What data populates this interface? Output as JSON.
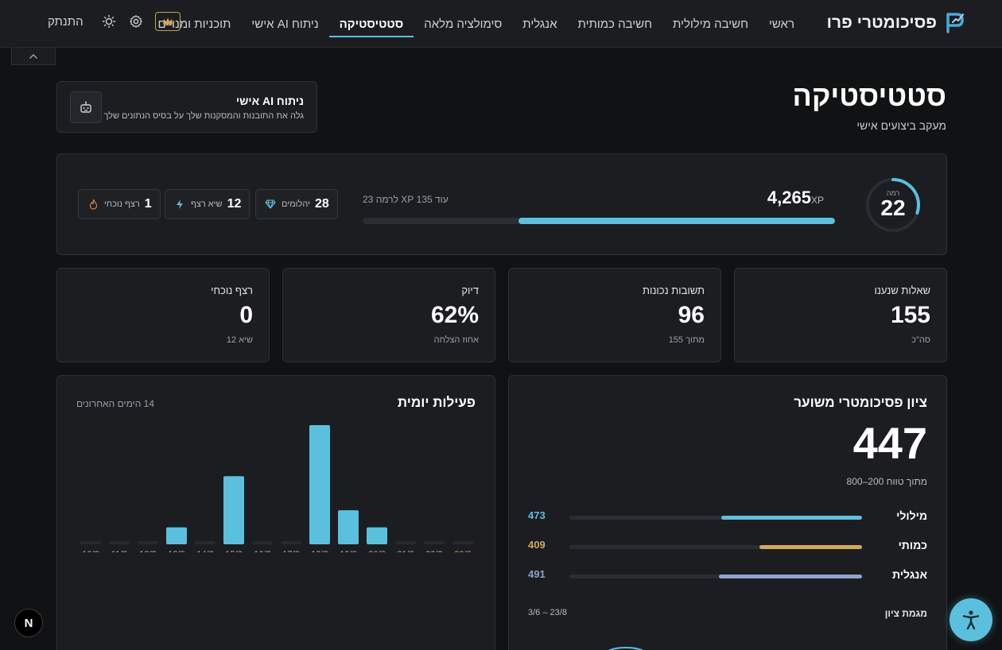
{
  "brand": {
    "name": "פסיכומטרי פרו"
  },
  "nav": {
    "items": [
      {
        "label": "ראשי",
        "active": false
      },
      {
        "label": "חשיבה מילולית",
        "active": false
      },
      {
        "label": "חשיבה כמותית",
        "active": false
      },
      {
        "label": "אנגלית",
        "active": false
      },
      {
        "label": "סימולציה מלאה",
        "active": false
      },
      {
        "label": "סטטיסטיקה",
        "active": true
      },
      {
        "label": "ניתוח AI אישי",
        "active": false
      },
      {
        "label": "תוכניות ומנויים",
        "active": false
      }
    ],
    "logout_label": "התנתק",
    "icons": {
      "premium": "crown-icon",
      "settings": "gear-icon",
      "theme": "sun-icon"
    }
  },
  "header": {
    "title": "סטטיסטיקה",
    "subtitle": "מעקב ביצועים אישי"
  },
  "ai_card": {
    "title": "ניתוח AI אישי",
    "description": "גלה את התובנות והמסקנות שלך על בסיס הנתונים שלך"
  },
  "level": {
    "label": "רמה",
    "value": "22",
    "ring_progress": 0.3,
    "xp": "4,265",
    "xp_unit": "XP",
    "next_text": "עוד 135 XP לרמה 23",
    "progress": 0.67
  },
  "chips": [
    {
      "value": "28",
      "label": "יהלומים",
      "icon": "diamond-icon"
    },
    {
      "value": "12",
      "label": "שיא רצף",
      "icon": "lightning-icon"
    },
    {
      "value": "1",
      "label": "רצף נוכחי",
      "icon": "flame-icon"
    }
  ],
  "summary": [
    {
      "label": "שאלות שנענו",
      "value": "155",
      "sub": "סה\"כ"
    },
    {
      "label": "תשובות נכונות",
      "value": "96",
      "sub": "מתוך 155"
    },
    {
      "label": "דיוק",
      "value": "62%",
      "sub": "אחוז הצלחה"
    },
    {
      "label": "רצף נוכחי",
      "value": "0",
      "sub": "שיא 12"
    }
  ],
  "score": {
    "title": "ציון פסיכומטרי משוער",
    "value": "447",
    "range_text": "מתוך טווח 200–800",
    "subjects": [
      {
        "name": "מילולי",
        "value": "473",
        "color": "#5bc0de",
        "fraction": 0.48
      },
      {
        "name": "כמותי",
        "value": "409",
        "color": "#d4a85a",
        "fraction": 0.35
      },
      {
        "name": "אנגלית",
        "value": "491",
        "color": "#8fa3cc",
        "fraction": 0.49
      }
    ],
    "trend_label": "מגמת ציון",
    "trend_range": "3/6 – 23/8"
  },
  "activity": {
    "title": "פעילות יומית",
    "subtitle": "14 הימים האחרונים"
  },
  "chart_data": {
    "type": "bar",
    "categories": [
      "10/8",
      "11/8",
      "12/8",
      "13/8",
      "14/8",
      "15/8",
      "16/8",
      "17/8",
      "18/8",
      "19/8",
      "20/8",
      "21/8",
      "22/8",
      "23/8"
    ],
    "values": [
      0,
      0,
      0,
      15,
      0,
      60,
      0,
      0,
      105,
      30,
      15,
      0,
      0,
      0
    ],
    "highlight_category": "23/8",
    "bar_color": "#5bc0de",
    "empty_color": "#26292e",
    "highlight_color": "#d4a85a"
  },
  "accessibility": {
    "icon": "accessibility-icon"
  },
  "next_badge": {
    "label": "N"
  }
}
